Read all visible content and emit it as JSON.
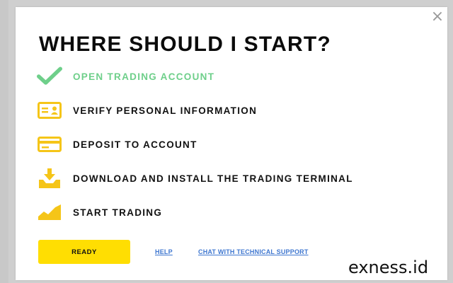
{
  "modal": {
    "title": "WHERE SHOULD I START?",
    "close_glyph": "×"
  },
  "steps": [
    {
      "label": "OPEN TRADING ACCOUNT",
      "icon": "checkmark-icon",
      "status": "done"
    },
    {
      "label": "VERIFY PERSONAL INFORMATION",
      "icon": "id-card-icon",
      "status": "pending"
    },
    {
      "label": "DEPOSIT TO ACCOUNT",
      "icon": "credit-card-icon",
      "status": "pending"
    },
    {
      "label": "DOWNLOAD AND INSTALL THE TRADING TERMINAL",
      "icon": "download-tray-icon",
      "status": "pending"
    },
    {
      "label": "START TRADING",
      "icon": "area-chart-icon",
      "status": "pending"
    }
  ],
  "actions": {
    "ready_label": "READY",
    "help_label": "HELP",
    "support_label": "CHAT WITH TECHNICAL SUPPORT"
  },
  "watermark": "exness.id",
  "colors": {
    "accent_yellow": "#ffde02",
    "done_green": "#6ecf8a",
    "link_blue": "#3f77d0",
    "icon_yellow": "#f5c518"
  }
}
